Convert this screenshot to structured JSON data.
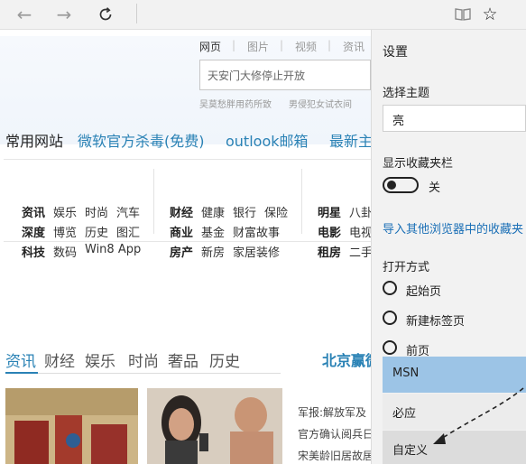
{
  "toolbar": {
    "back_icon": "arrow-left-icon",
    "forward_icon": "arrow-right-icon",
    "refresh_icon": "refresh-icon",
    "reading_icon": "reading-view-icon",
    "favorite_icon": "star-icon"
  },
  "page": {
    "search_tabs": [
      "网页",
      "图片",
      "视频",
      "资讯"
    ],
    "search_placeholder": "天安门大修停止开放",
    "hot_words": [
      "吴莫愁胖用药所致",
      "男侵犯女试衣间"
    ],
    "common_sites_label": "常用网站",
    "site_links": [
      "微软官方杀毒(免费)",
      "outlook邮箱",
      "最新主"
    ],
    "categories": {
      "col1": [
        [
          "资讯",
          "娱乐",
          "时尚",
          "汽车"
        ],
        [
          "深度",
          "博览",
          "历史",
          "图汇"
        ],
        [
          "科技",
          "数码",
          "Win8 App"
        ]
      ],
      "col2": [
        [
          "财经",
          "健康",
          "银行",
          "保险"
        ],
        [
          "商业",
          "基金",
          "财富故事"
        ],
        [
          "房产",
          "新房",
          "家居装修"
        ]
      ],
      "col3": [
        [
          "明星",
          "八卦"
        ],
        [
          "电影",
          "电视"
        ],
        [
          "租房",
          "二手"
        ]
      ]
    },
    "news_tabs": [
      "资讯",
      "财经",
      "娱乐",
      "时尚",
      "奢品",
      "历史"
    ],
    "news_title": "北京赢微",
    "news_lines": [
      "军报:解放军及",
      "官方确认阅兵日",
      "宋美龄旧居故居"
    ]
  },
  "settings": {
    "title": "设置",
    "theme_label": "选择主题",
    "theme_value": "亮",
    "favorites_bar_label": "显示收藏夹栏",
    "favorites_bar_state": "关",
    "import_link": "导入其他浏览器中的收藏夹",
    "open_with_label": "打开方式",
    "radio_options": [
      "起始页",
      "新建标签页",
      "前页"
    ],
    "dropdown_options": [
      "MSN",
      "必应",
      "自定义"
    ]
  },
  "colors": {
    "accent": "#2a82b5",
    "selected_item": "#9cc4e6",
    "panel_bg": "#f2f2f2"
  }
}
